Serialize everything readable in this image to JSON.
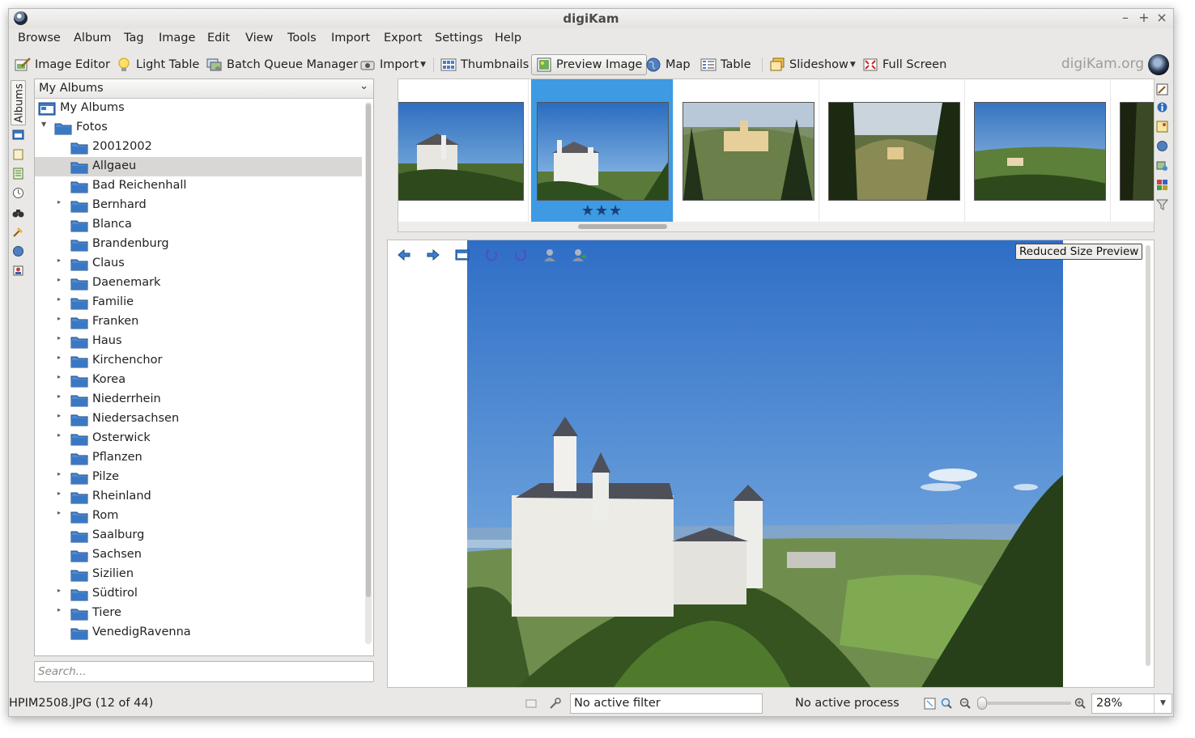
{
  "window": {
    "title": "digiKam"
  },
  "menubar": [
    "Browse",
    "Album",
    "Tag",
    "Image",
    "Edit",
    "View",
    "Tools",
    "Import",
    "Export",
    "Settings",
    "Help"
  ],
  "toolbar": {
    "image_editor": "Image Editor",
    "light_table": "Light Table",
    "batch_queue": "Batch Queue Manager",
    "import": "Import",
    "thumbnails": "Thumbnails",
    "preview_image": "Preview Image",
    "map": "Map",
    "table": "Table",
    "slideshow": "Slideshow",
    "full_screen": "Full Screen",
    "brand": "digiKam.org"
  },
  "sidebar": {
    "albums_tab": "Albums"
  },
  "album_panel": {
    "selector": "My Albums",
    "root": "My Albums",
    "parent": "Fotos",
    "selected": "Allgaeu",
    "albums": [
      {
        "name": "20012002",
        "expandable": false
      },
      {
        "name": "Allgaeu",
        "expandable": false
      },
      {
        "name": "Bad Reichenhall",
        "expandable": false
      },
      {
        "name": "Bernhard",
        "expandable": true
      },
      {
        "name": "Blanca",
        "expandable": false
      },
      {
        "name": "Brandenburg",
        "expandable": false
      },
      {
        "name": "Claus",
        "expandable": true
      },
      {
        "name": "Daenemark",
        "expandable": true
      },
      {
        "name": "Familie",
        "expandable": true
      },
      {
        "name": "Franken",
        "expandable": true
      },
      {
        "name": "Haus",
        "expandable": true
      },
      {
        "name": "Kirchenchor",
        "expandable": true
      },
      {
        "name": "Korea",
        "expandable": true
      },
      {
        "name": "Niederrhein",
        "expandable": true
      },
      {
        "name": "Niedersachsen",
        "expandable": true
      },
      {
        "name": "Osterwick",
        "expandable": true
      },
      {
        "name": "Pflanzen",
        "expandable": false
      },
      {
        "name": "Pilze",
        "expandable": true
      },
      {
        "name": "Rheinland",
        "expandable": true
      },
      {
        "name": "Rom",
        "expandable": true
      },
      {
        "name": "Saalburg",
        "expandable": false
      },
      {
        "name": "Sachsen",
        "expandable": false
      },
      {
        "name": "Sizilien",
        "expandable": false
      },
      {
        "name": "Südtirol",
        "expandable": true
      },
      {
        "name": "Tiere",
        "expandable": true
      },
      {
        "name": "VenedigRavenna",
        "expandable": false
      }
    ],
    "search_placeholder": "Search..."
  },
  "thumbnails": {
    "current_index": 1,
    "current_rating": 3,
    "count_visible": 6
  },
  "preview": {
    "badge": "Reduced Size Preview"
  },
  "status": {
    "file": "HPIM2508.JPG (12 of 44)",
    "filter": "No active filter",
    "process": "No active process",
    "zoom": "28%",
    "zoom_level": 0.28
  },
  "colors": {
    "selection_blue": "#3d9ae3",
    "star": "#1c3f7a",
    "folder_blue": "#3b78c4"
  }
}
